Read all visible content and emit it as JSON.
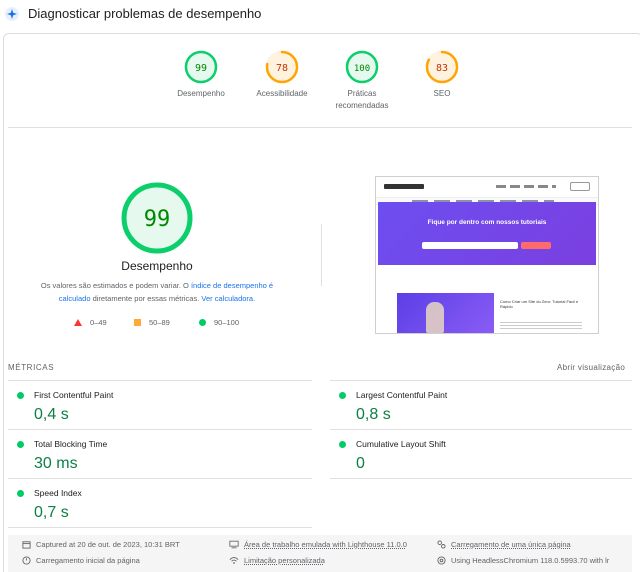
{
  "header": {
    "title": "Diagnosticar problemas de desempenho",
    "icon": "lighthouse-spark-icon"
  },
  "categories": [
    {
      "score": "99",
      "label": "Desempenho",
      "value": 99,
      "color": "#0cce6b",
      "text_color": "#008800"
    },
    {
      "score": "78",
      "label": "Acessibilidade",
      "value": 78,
      "color": "#ffa400",
      "text_color": "#c33300"
    },
    {
      "score": "100",
      "label": "Práticas recomendadas",
      "value": 100,
      "color": "#0cce6b",
      "text_color": "#008800"
    },
    {
      "score": "83",
      "label": "SEO",
      "value": 83,
      "color": "#ffa400",
      "text_color": "#c33300"
    }
  ],
  "main_gauge": {
    "score": "99",
    "value": 99,
    "label": "Desempenho",
    "color": "#0cce6b",
    "desc_before": "Os valores são estimados e podem variar. O ",
    "desc_link": "índice de desempenho é calculado",
    "desc_mid": " diretamente por essas métricas. ",
    "desc_link2": "Ver calculadora."
  },
  "legend": {
    "fail": "0–49",
    "average": "50–89",
    "pass": "90–100"
  },
  "screenshot": {
    "hero_title": "Fique por dentro com nossos tutoriais",
    "article_title": "Como Criar um Site do Zero: Tutorial Fácil e Rápido"
  },
  "metrics": {
    "title": "MÉTRICAS",
    "toggle": "Abrir visualização",
    "items": [
      {
        "name": "First Contentful Paint",
        "value": "0,4 s"
      },
      {
        "name": "Largest Contentful Paint",
        "value": "0,8 s"
      },
      {
        "name": "Total Blocking Time",
        "value": "30 ms"
      },
      {
        "name": "Cumulative Layout Shift",
        "value": "0"
      },
      {
        "name": "Speed Index",
        "value": "0,7 s"
      }
    ]
  },
  "footer": {
    "captured": "Captured at 20 de out. de 2023, 10:31 BRT",
    "emulated": "Área de trabalho emulada with Lighthouse 11.0.0",
    "single_page": "Carregamento de uma única página",
    "initial_load": "Carregamento inicial da página",
    "throttling": "Limitação personalizada",
    "browser": "Using HeadlessChromium 118.0.5993.70 with lr"
  },
  "colors": {
    "pass": "#0cce6b",
    "average": "#ffa400",
    "fail": "#ff3333",
    "link": "#1a73e8"
  }
}
